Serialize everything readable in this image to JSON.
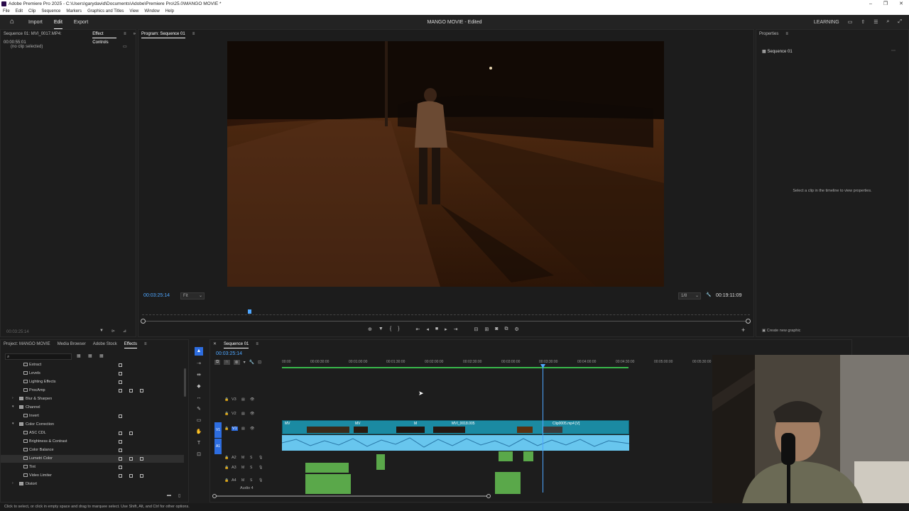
{
  "window": {
    "title": "Adobe Premiere Pro 2025 - C:\\Users\\garydavid\\Documents\\Adobe\\Premiere Pro\\25.0\\MANGO MOVIE *"
  },
  "menu": [
    "File",
    "Edit",
    "Clip",
    "Sequence",
    "Markers",
    "Graphics and Titles",
    "View",
    "Window",
    "Help"
  ],
  "appbar": {
    "tabs": [
      "Import",
      "Edit",
      "Export"
    ],
    "active_tab": "Edit",
    "project_title": "MANGO MOVIE - Edited",
    "learning_label": "LEARNING"
  },
  "effect_controls": {
    "source_label": "Sequence 01: MVI_0017.MP4: 00:00:55:01",
    "tab_label": "Effect Controls",
    "no_clip": "(no clip selected)",
    "bottom_tc": "00:03:25:14"
  },
  "program": {
    "tab_label": "Program: Sequence 01",
    "current_tc": "00:03:25:14",
    "fit_label": "Fit",
    "res_label": "1/8",
    "duration_tc": "00:19:11:09"
  },
  "properties": {
    "tab_label": "Properties",
    "sequence_label": "Sequence 01",
    "hint": "Select a clip in the timeline to view properties.",
    "create_graphic": "Create new graphic"
  },
  "project_panel": {
    "tabs": [
      "Project: MANGO MOVIE",
      "Media Browser",
      "Adobe Stock",
      "Effects"
    ],
    "active_tab": "Effects",
    "items": [
      {
        "label": "Extract",
        "kind": "effect",
        "depth": 2
      },
      {
        "label": "Levels",
        "kind": "effect",
        "depth": 2
      },
      {
        "label": "Lighting Effects",
        "kind": "effect",
        "depth": 2
      },
      {
        "label": "ProcAmp",
        "kind": "effect",
        "depth": 2
      },
      {
        "label": "Blur & Sharpen",
        "kind": "folder",
        "depth": 1
      },
      {
        "label": "Channel",
        "kind": "folder",
        "depth": 1
      },
      {
        "label": "Invert",
        "kind": "effect",
        "depth": 2
      },
      {
        "label": "Color Correction",
        "kind": "folder",
        "depth": 1
      },
      {
        "label": "ASC CDL",
        "kind": "effect",
        "depth": 2
      },
      {
        "label": "Brightness & Contrast",
        "kind": "effect",
        "depth": 2
      },
      {
        "label": "Color Balance",
        "kind": "effect",
        "depth": 2
      },
      {
        "label": "Lumetri Color",
        "kind": "effect",
        "depth": 2
      },
      {
        "label": "Tint",
        "kind": "effect",
        "depth": 2
      },
      {
        "label": "Video Limiter",
        "kind": "effect",
        "depth": 2
      },
      {
        "label": "Distort",
        "kind": "folder",
        "depth": 1
      }
    ]
  },
  "timeline": {
    "tab_label": "Sequence 01",
    "current_tc": "00:03:25:14",
    "ruler": [
      "00:00",
      "00:00:30:00",
      "00:01:00:00",
      "00:01:30:00",
      "00:02:00:00",
      "00:02:30:00",
      "00:03:00:00",
      "00:03:30:00",
      "00:04:00:00",
      "00:04:30:00",
      "00:05:00:00",
      "00:05:30:00"
    ],
    "video_tracks": [
      "V3",
      "V2",
      "V1"
    ],
    "audio_tracks": [
      "A2",
      "A3",
      "A4"
    ],
    "audio4_label": "Audio 4",
    "source_v1": "V1",
    "source_a1": "A1",
    "clip_labels": [
      "MV",
      "MV",
      "M",
      "MVI_0018.005",
      "Clip0005.mp4 [V]"
    ]
  },
  "status": "Click to select, or click in empty space and drag to marquee select. Use Shift, Alt, and Ctrl for other options.",
  "colors": {
    "accent": "#4ea6ff",
    "video_clip": "#1b8aa2",
    "audio_clip": "#68c6ee",
    "audio_green": "#5aa84a"
  }
}
